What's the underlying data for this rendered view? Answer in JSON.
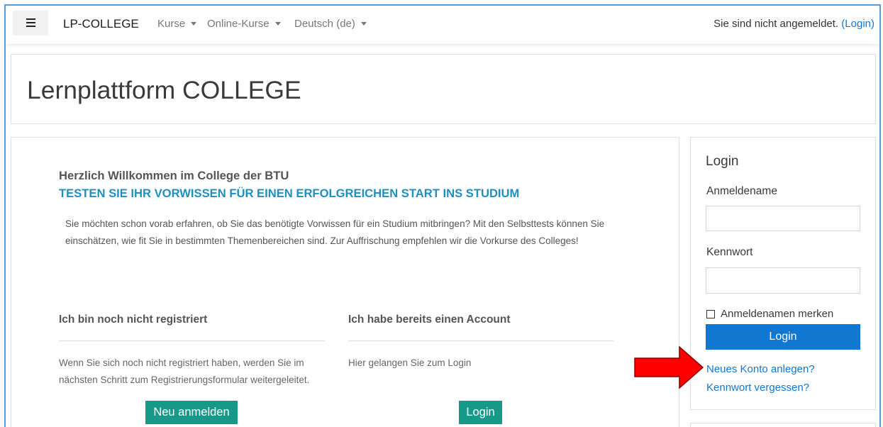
{
  "colors": {
    "frame": "#5b9bd5",
    "link": "#1177d1",
    "primary_button": "#1177d1",
    "teal_button": "#17998a",
    "headline": "#1f8fbf",
    "annotation_arrow": "#ff0000"
  },
  "navbar": {
    "menu_icon": "hamburger-menu-icon",
    "brand": "LP-COLLEGE",
    "menus": [
      {
        "label": "Kurse",
        "icon": "caret-down-icon"
      },
      {
        "label": "Online-Kurse",
        "icon": "caret-down-icon"
      },
      {
        "label": "Deutsch (de)",
        "icon": "caret-down-icon"
      }
    ],
    "login_status": "Sie sind nicht angemeldet.",
    "login_link": "(Login)"
  },
  "header": {
    "title": "Lernplattform COLLEGE"
  },
  "main": {
    "welcome": "Herzlich Willkommen im College der BTU",
    "headline": "TESTEN SIE IHR VORWISSEN FÜR EINEN ERFOLGREICHEN START INS STUDIUM",
    "intro_lines": [
      "Sie möchten schon vorab erfahren, ob Sie das benötigte Vorwissen für ein Studium mitbringen? Mit den Selbsttests können Sie",
      "einschätzen, wie fit Sie in bestimmten Themenbereichen sind. Zur Auffrischung empfehlen wir die Vorkurse des Colleges!"
    ],
    "columns": [
      {
        "heading": "Ich bin noch nicht registriert",
        "text_lines": [
          "Wenn Sie sich noch nicht registriert haben, werden Sie im",
          "nächsten Schritt zum Registrierungsformular weitergeleitet."
        ],
        "button": "Neu anmelden"
      },
      {
        "heading": "Ich habe bereits einen Account",
        "text_lines": [
          "Hier gelangen Sie zum Login"
        ],
        "button": "Login"
      }
    ]
  },
  "login_block": {
    "title": "Login",
    "username_label": "Anmeldename",
    "password_label": "Kennwort",
    "remember_label": "Anmeldenamen merken",
    "remember_checked": false,
    "submit_label": "Login",
    "signup_link": "Neues Konto anlegen?",
    "forgot_link": "Kennwort vergessen?"
  },
  "annotation": {
    "icon": "red-arrow-icon"
  }
}
